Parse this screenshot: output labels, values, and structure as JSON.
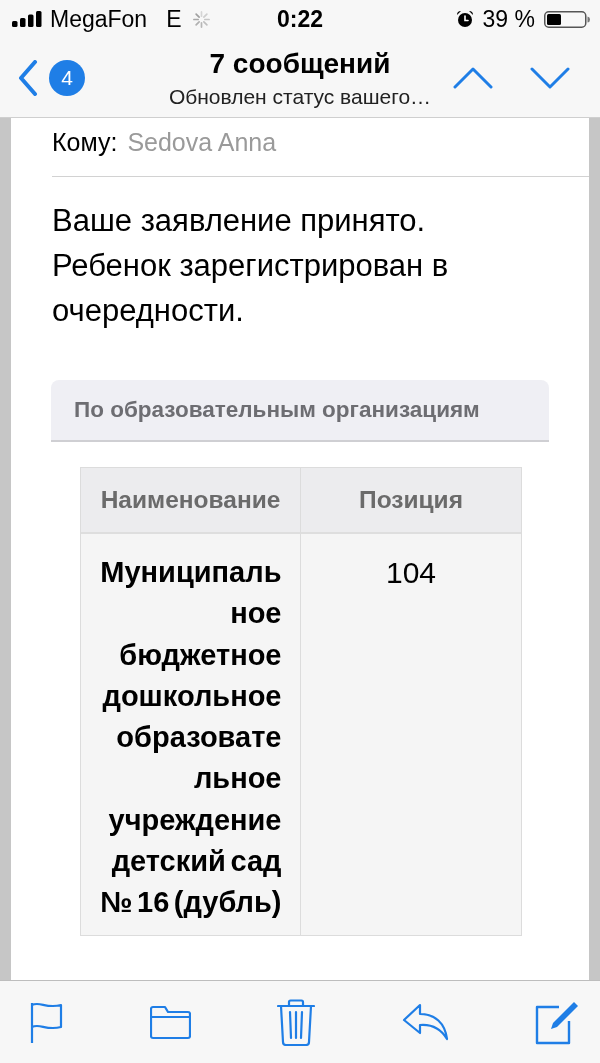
{
  "status_bar": {
    "carrier": "MegaFon",
    "network": "E",
    "time": "0:22",
    "battery_percent": "39 %"
  },
  "nav_bar": {
    "unread_count": "4",
    "title": "7 сообщений",
    "subtitle": "Обновлен статус вашего…"
  },
  "message": {
    "recipient_label": "Кому:",
    "recipient": "Sedova Anna",
    "body": "Ваше заявление принято. Ребенок зарегистрирован в очередности.",
    "section_title": "По образовательным организациям",
    "table": {
      "columns": [
        "Наименование",
        "Позиция"
      ],
      "rows": [
        [
          "Муниципальное бюджетное дошкольное образовательное учреждение детский сад № 16 (дубль)",
          "104"
        ]
      ]
    }
  }
}
